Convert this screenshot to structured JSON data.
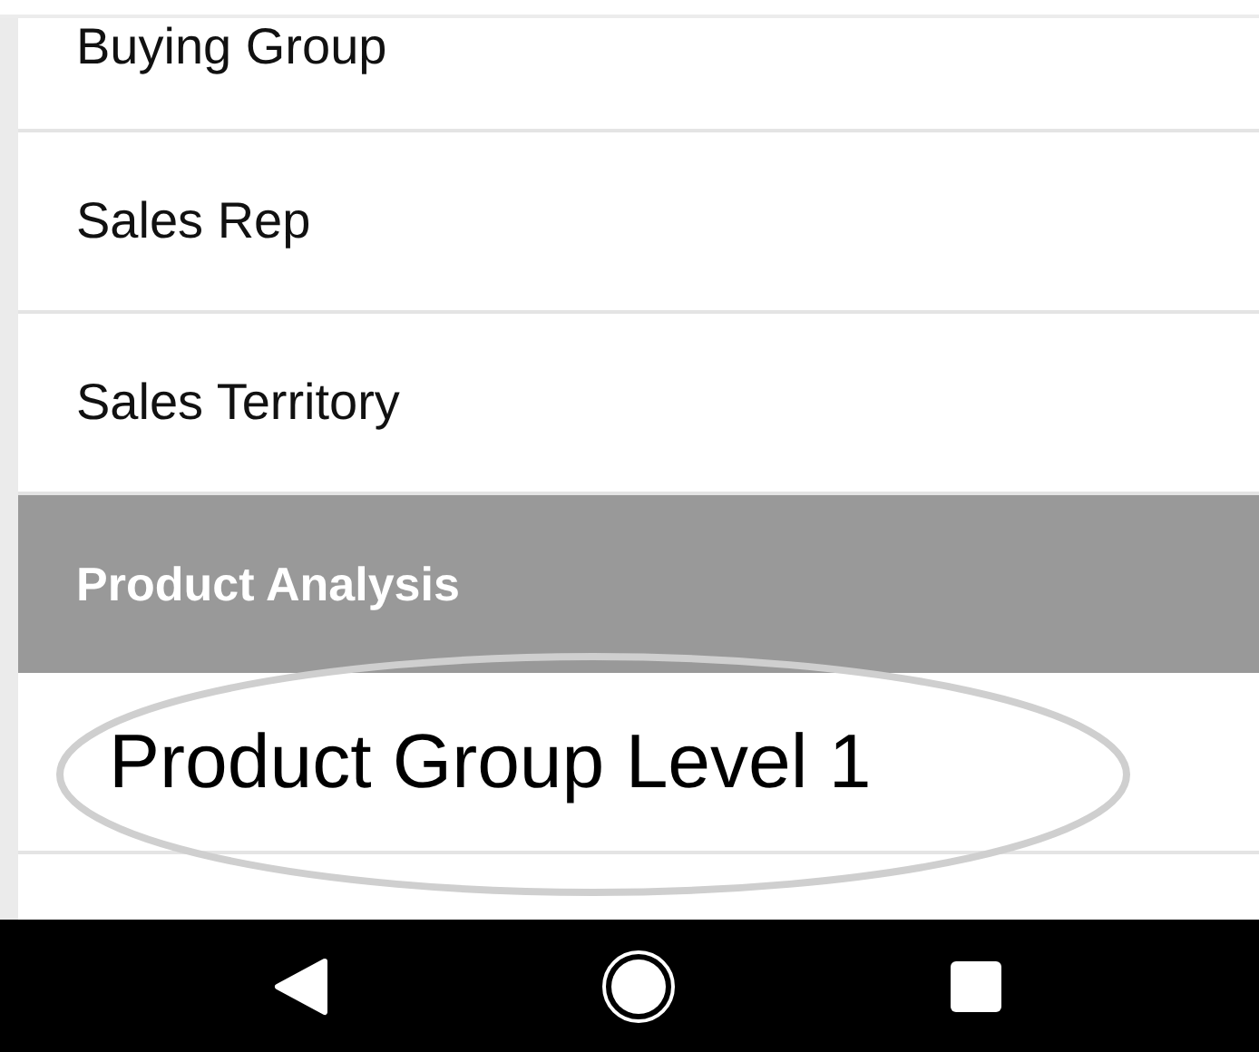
{
  "list": {
    "items": [
      {
        "kind": "item",
        "label": "Buying Group",
        "circled": false
      },
      {
        "kind": "item",
        "label": "Sales Rep",
        "circled": false
      },
      {
        "kind": "item",
        "label": "Sales Territory",
        "circled": false
      },
      {
        "kind": "header",
        "label": "Product Analysis",
        "circled": false
      },
      {
        "kind": "item",
        "label": "Product Group Level 1",
        "circled": true
      }
    ]
  }
}
